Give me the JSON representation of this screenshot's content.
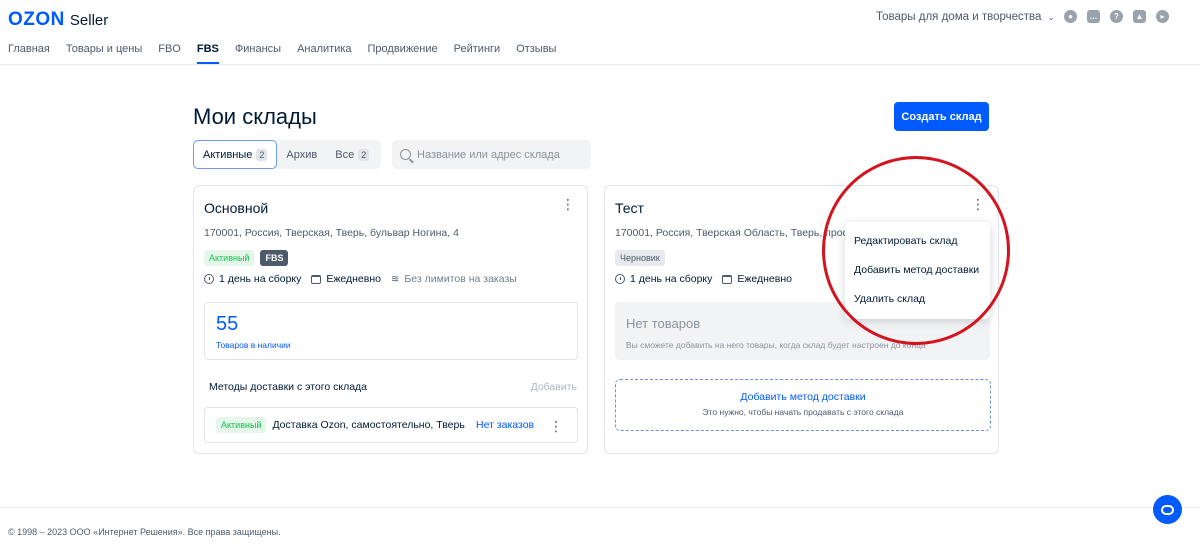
{
  "header": {
    "logo_brand": "OZON",
    "logo_product": "Seller",
    "store_selector": "Товары для дома и творчества",
    "icons": [
      "user-icon",
      "chat-icon",
      "help-icon",
      "education-icon",
      "announcements-icon"
    ]
  },
  "nav": {
    "items": [
      {
        "label": "Главная"
      },
      {
        "label": "Товары и цены"
      },
      {
        "label": "FBO"
      },
      {
        "label": "FBS",
        "active": true
      },
      {
        "label": "Финансы"
      },
      {
        "label": "Аналитика"
      },
      {
        "label": "Продвижение"
      },
      {
        "label": "Рейтинги"
      },
      {
        "label": "Отзывы"
      }
    ]
  },
  "main": {
    "title": "Мои склады",
    "create_button": "Создать склад",
    "tabs": [
      {
        "label": "Активные",
        "count": "2",
        "active": true
      },
      {
        "label": "Архив",
        "count": ""
      },
      {
        "label": "Все",
        "count": "2"
      }
    ],
    "search_placeholder": "Название или адрес склада"
  },
  "warehouses": [
    {
      "name": "Основной",
      "address": "170001, Россия, Тверская, Тверь, бульвар Ногина, 4",
      "status": "Активный",
      "type_badge": "FBS",
      "assembly": "1 день на сборку",
      "schedule": "Ежедневно",
      "limits": "Без лимитов на заказы",
      "stock_count": "55",
      "stock_label": "Товаров в наличии",
      "methods_title": "Методы доставки с этого склада",
      "methods_add": "Добавить",
      "method": {
        "status": "Активный",
        "name": "Доставка Ozon, самостоятельно, Тверь",
        "orders": "Нет заказов"
      }
    },
    {
      "name": "Тест",
      "address": "170001, Россия, Тверская Область, Тверь, просп",
      "status": "Черновик",
      "assembly": "1 день на сборку",
      "schedule": "Ежедневно",
      "empty_title": "Нет товаров",
      "empty_desc": "Вы сможете добавить на него товары, когда склад будет настроен до конца",
      "add_method_title": "Добавить метод доставки",
      "add_method_desc": "Это нужно, чтобы начать продавать с этого склада"
    }
  ],
  "dropdown": {
    "items": [
      "Редактировать склад",
      "Добавить метод доставки",
      "Удалить склад"
    ]
  },
  "footer": {
    "copyright": "© 1998 – 2023 ООО «Интернет Решения». Все права защищены."
  },
  "colors": {
    "accent": "#005bff",
    "annotation": "#d3131e",
    "active_green": "#10c44c"
  }
}
